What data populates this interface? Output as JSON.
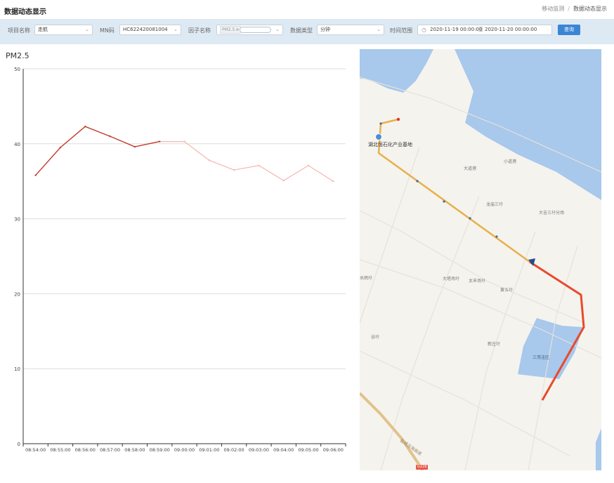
{
  "header": {
    "title": "数据动态显示",
    "breadcrumb": [
      "移动监测",
      "数据动态显示"
    ]
  },
  "filters": {
    "project_label": "项目名称",
    "project_value": "走航",
    "mn_label": "MN码",
    "mn_value": "HC622420081004",
    "factor_label": "因子名称",
    "factor_tag": "PM2.5",
    "datatype_label": "数据类型",
    "datatype_value": "分钟",
    "range_label": "时间范围",
    "range_start": "2020-11-19 00:00:00",
    "range_sep": "至",
    "range_end": "2020-11-20 00:00:00",
    "query_label": "查询"
  },
  "chart_data": {
    "type": "line",
    "title": "PM2.5",
    "categories": [
      "08:54:00",
      "08:55:00",
      "08:56:00",
      "08:57:00",
      "08:58:00",
      "08:59:00",
      "09:00:00",
      "09:01:00",
      "09:02:00",
      "09:03:00",
      "09:04:00",
      "09:05:00",
      "09:06:00"
    ],
    "series": [
      {
        "values": [
          35.8,
          39.5,
          42.3,
          41.0,
          39.6,
          40.3,
          40.3,
          37.8,
          36.5,
          37.1,
          35.1,
          37.1,
          35.0
        ],
        "highlighted_points": 6,
        "color": "#c0392b",
        "faded_color": "#f4b7ad"
      }
    ],
    "ylim": [
      0,
      50
    ],
    "yticks": [
      0,
      10,
      20,
      30,
      40,
      50
    ],
    "grid": true
  },
  "map": {
    "poi_label": "湖北恒石化产业基地",
    "labels": [
      "大道港",
      "小道港",
      "龙庙三圩",
      "大吉三圩分场",
      "水雨圩",
      "太丰场圩",
      "黄五圩",
      "大塔场圩",
      "谷圩",
      "新庄圩",
      "蒋圩",
      "三荡洼区"
    ],
    "road_name": "盐城沿海高速",
    "road_badge": "G228",
    "colors": {
      "water": "#a8c8ec",
      "route": "#e8b04a",
      "highlight": "#e84a2c"
    }
  }
}
